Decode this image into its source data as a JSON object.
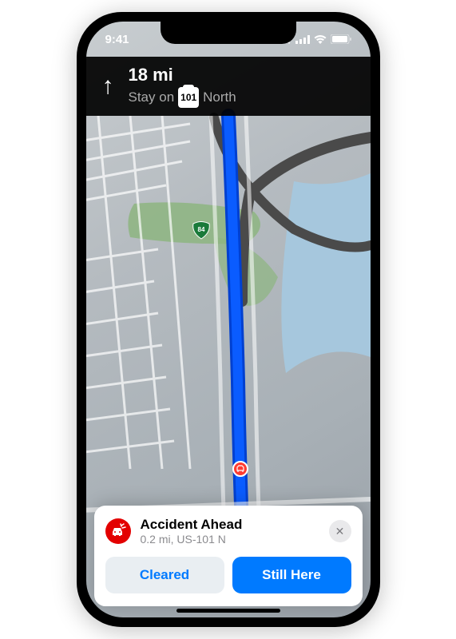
{
  "statusbar": {
    "time": "9:41",
    "loc_indicator": "◀",
    "signal": "signal-icon",
    "wifi": "wifi-icon",
    "battery": "battery-icon"
  },
  "navigation": {
    "distance": "18 mi",
    "instruction_prefix": "Stay on",
    "route_number": "101",
    "instruction_suffix": "North",
    "arrow": "↑"
  },
  "map": {
    "highway_marker": "84",
    "route_color": "#0a5cff",
    "route_outline": "#0040d0",
    "park_color": "#8db580",
    "water_color": "#a6c7dd",
    "road_color": "#ffffff",
    "highway_color": "#4a4a4a",
    "incident_marker_color": "#ff3b30"
  },
  "alert": {
    "title": "Accident Ahead",
    "subtitle": "0.2 mi, US-101 N",
    "icon": "accident-icon",
    "icon_bg": "#e30000",
    "close_symbol": "✕",
    "button_secondary": "Cleared",
    "button_primary": "Still Here",
    "primary_color": "#007aff"
  }
}
